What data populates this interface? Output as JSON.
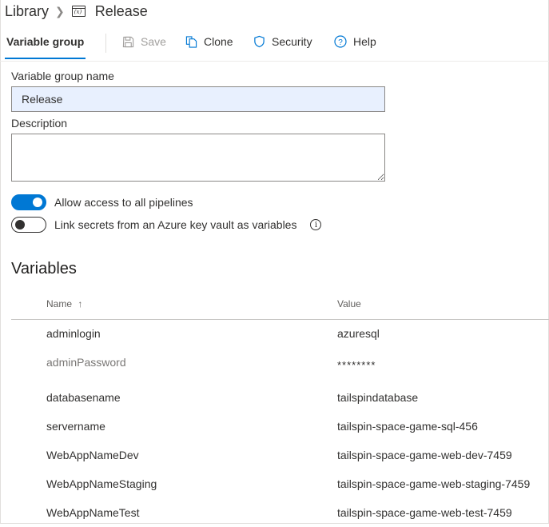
{
  "breadcrumb": {
    "root": "Library",
    "current": "Release"
  },
  "toolbar": {
    "tab": "Variable group",
    "save": "Save",
    "clone": "Clone",
    "security": "Security",
    "help": "Help"
  },
  "form": {
    "name_label": "Variable group name",
    "name_value": "Release",
    "description_label": "Description",
    "description_value": ""
  },
  "toggles": {
    "allow_access": {
      "label": "Allow access to all pipelines",
      "on": true
    },
    "key_vault": {
      "label": "Link secrets from an Azure key vault as variables",
      "on": false
    }
  },
  "variables": {
    "title": "Variables",
    "headers": {
      "name": "Name",
      "sort": "↑",
      "value": "Value"
    },
    "rows": [
      {
        "name": "adminlogin",
        "value": "azuresql",
        "secret": false
      },
      {
        "name": "adminPassword",
        "value": "********",
        "secret": true
      },
      {
        "name": "databasename",
        "value": "tailspindatabase",
        "secret": false
      },
      {
        "name": "servername",
        "value": "tailspin-space-game-sql-456",
        "secret": false
      },
      {
        "name": "WebAppNameDev",
        "value": "tailspin-space-game-web-dev-7459",
        "secret": false
      },
      {
        "name": "WebAppNameStaging",
        "value": "tailspin-space-game-web-staging-7459",
        "secret": false
      },
      {
        "name": "WebAppNameTest",
        "value": "tailspin-space-game-web-test-7459",
        "secret": false
      }
    ]
  },
  "colors": {
    "accent": "#0078d4",
    "input_fill": "#e8f0fe",
    "muted_text": "#797775"
  }
}
